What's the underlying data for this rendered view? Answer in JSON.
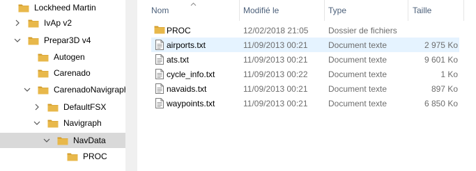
{
  "nav_tree": {
    "items": [
      {
        "label": "Lockheed Martin",
        "expander": "none",
        "selected": false
      },
      {
        "label": "IvAp v2",
        "expander": "collapsed",
        "selected": false
      },
      {
        "label": "Prepar3D v4",
        "expander": "expanded",
        "selected": false
      },
      {
        "label": "Autogen",
        "expander": "none",
        "selected": false
      },
      {
        "label": "Carenado",
        "expander": "none",
        "selected": false
      },
      {
        "label": "CarenadoNavigraph",
        "expander": "expanded",
        "selected": false
      },
      {
        "label": "DefaultFSX",
        "expander": "collapsed",
        "selected": false
      },
      {
        "label": "Navigraph",
        "expander": "expanded",
        "selected": false
      },
      {
        "label": "NavData",
        "expander": "expanded",
        "selected": true
      },
      {
        "label": "PROC",
        "expander": "none",
        "selected": false
      }
    ]
  },
  "details": {
    "columns": {
      "name": "Nom",
      "modified": "Modifié le",
      "type": "Type",
      "size": "Taille"
    },
    "rows": [
      {
        "name": "PROC",
        "modified": "12/02/2018 21:05",
        "type": "Dossier de fichiers",
        "size": "",
        "icon": "folder-icon",
        "hover": false
      },
      {
        "name": "airports.txt",
        "modified": "11/09/2013 00:21",
        "type": "Document texte",
        "size": "2 975 Ko",
        "icon": "text-file-icon",
        "hover": true
      },
      {
        "name": "ats.txt",
        "modified": "11/09/2013 00:21",
        "type": "Document texte",
        "size": "9 601 Ko",
        "icon": "text-file-icon",
        "hover": false
      },
      {
        "name": "cycle_info.txt",
        "modified": "11/09/2013 00:22",
        "type": "Document texte",
        "size": "1 Ko",
        "icon": "text-file-icon",
        "hover": false
      },
      {
        "name": "navaids.txt",
        "modified": "11/09/2013 00:21",
        "type": "Document texte",
        "size": "897 Ko",
        "icon": "text-file-icon",
        "hover": false
      },
      {
        "name": "waypoints.txt",
        "modified": "11/09/2013 00:21",
        "type": "Document texte",
        "size": "6 850 Ko",
        "icon": "text-file-icon",
        "hover": false
      }
    ]
  },
  "colors": {
    "folder": "#e8b84b",
    "folder_dark": "#d29b2a",
    "hover_row": "#e5f3ff",
    "selected_nav": "#d9d9d9",
    "header_text": "#4c607a"
  }
}
